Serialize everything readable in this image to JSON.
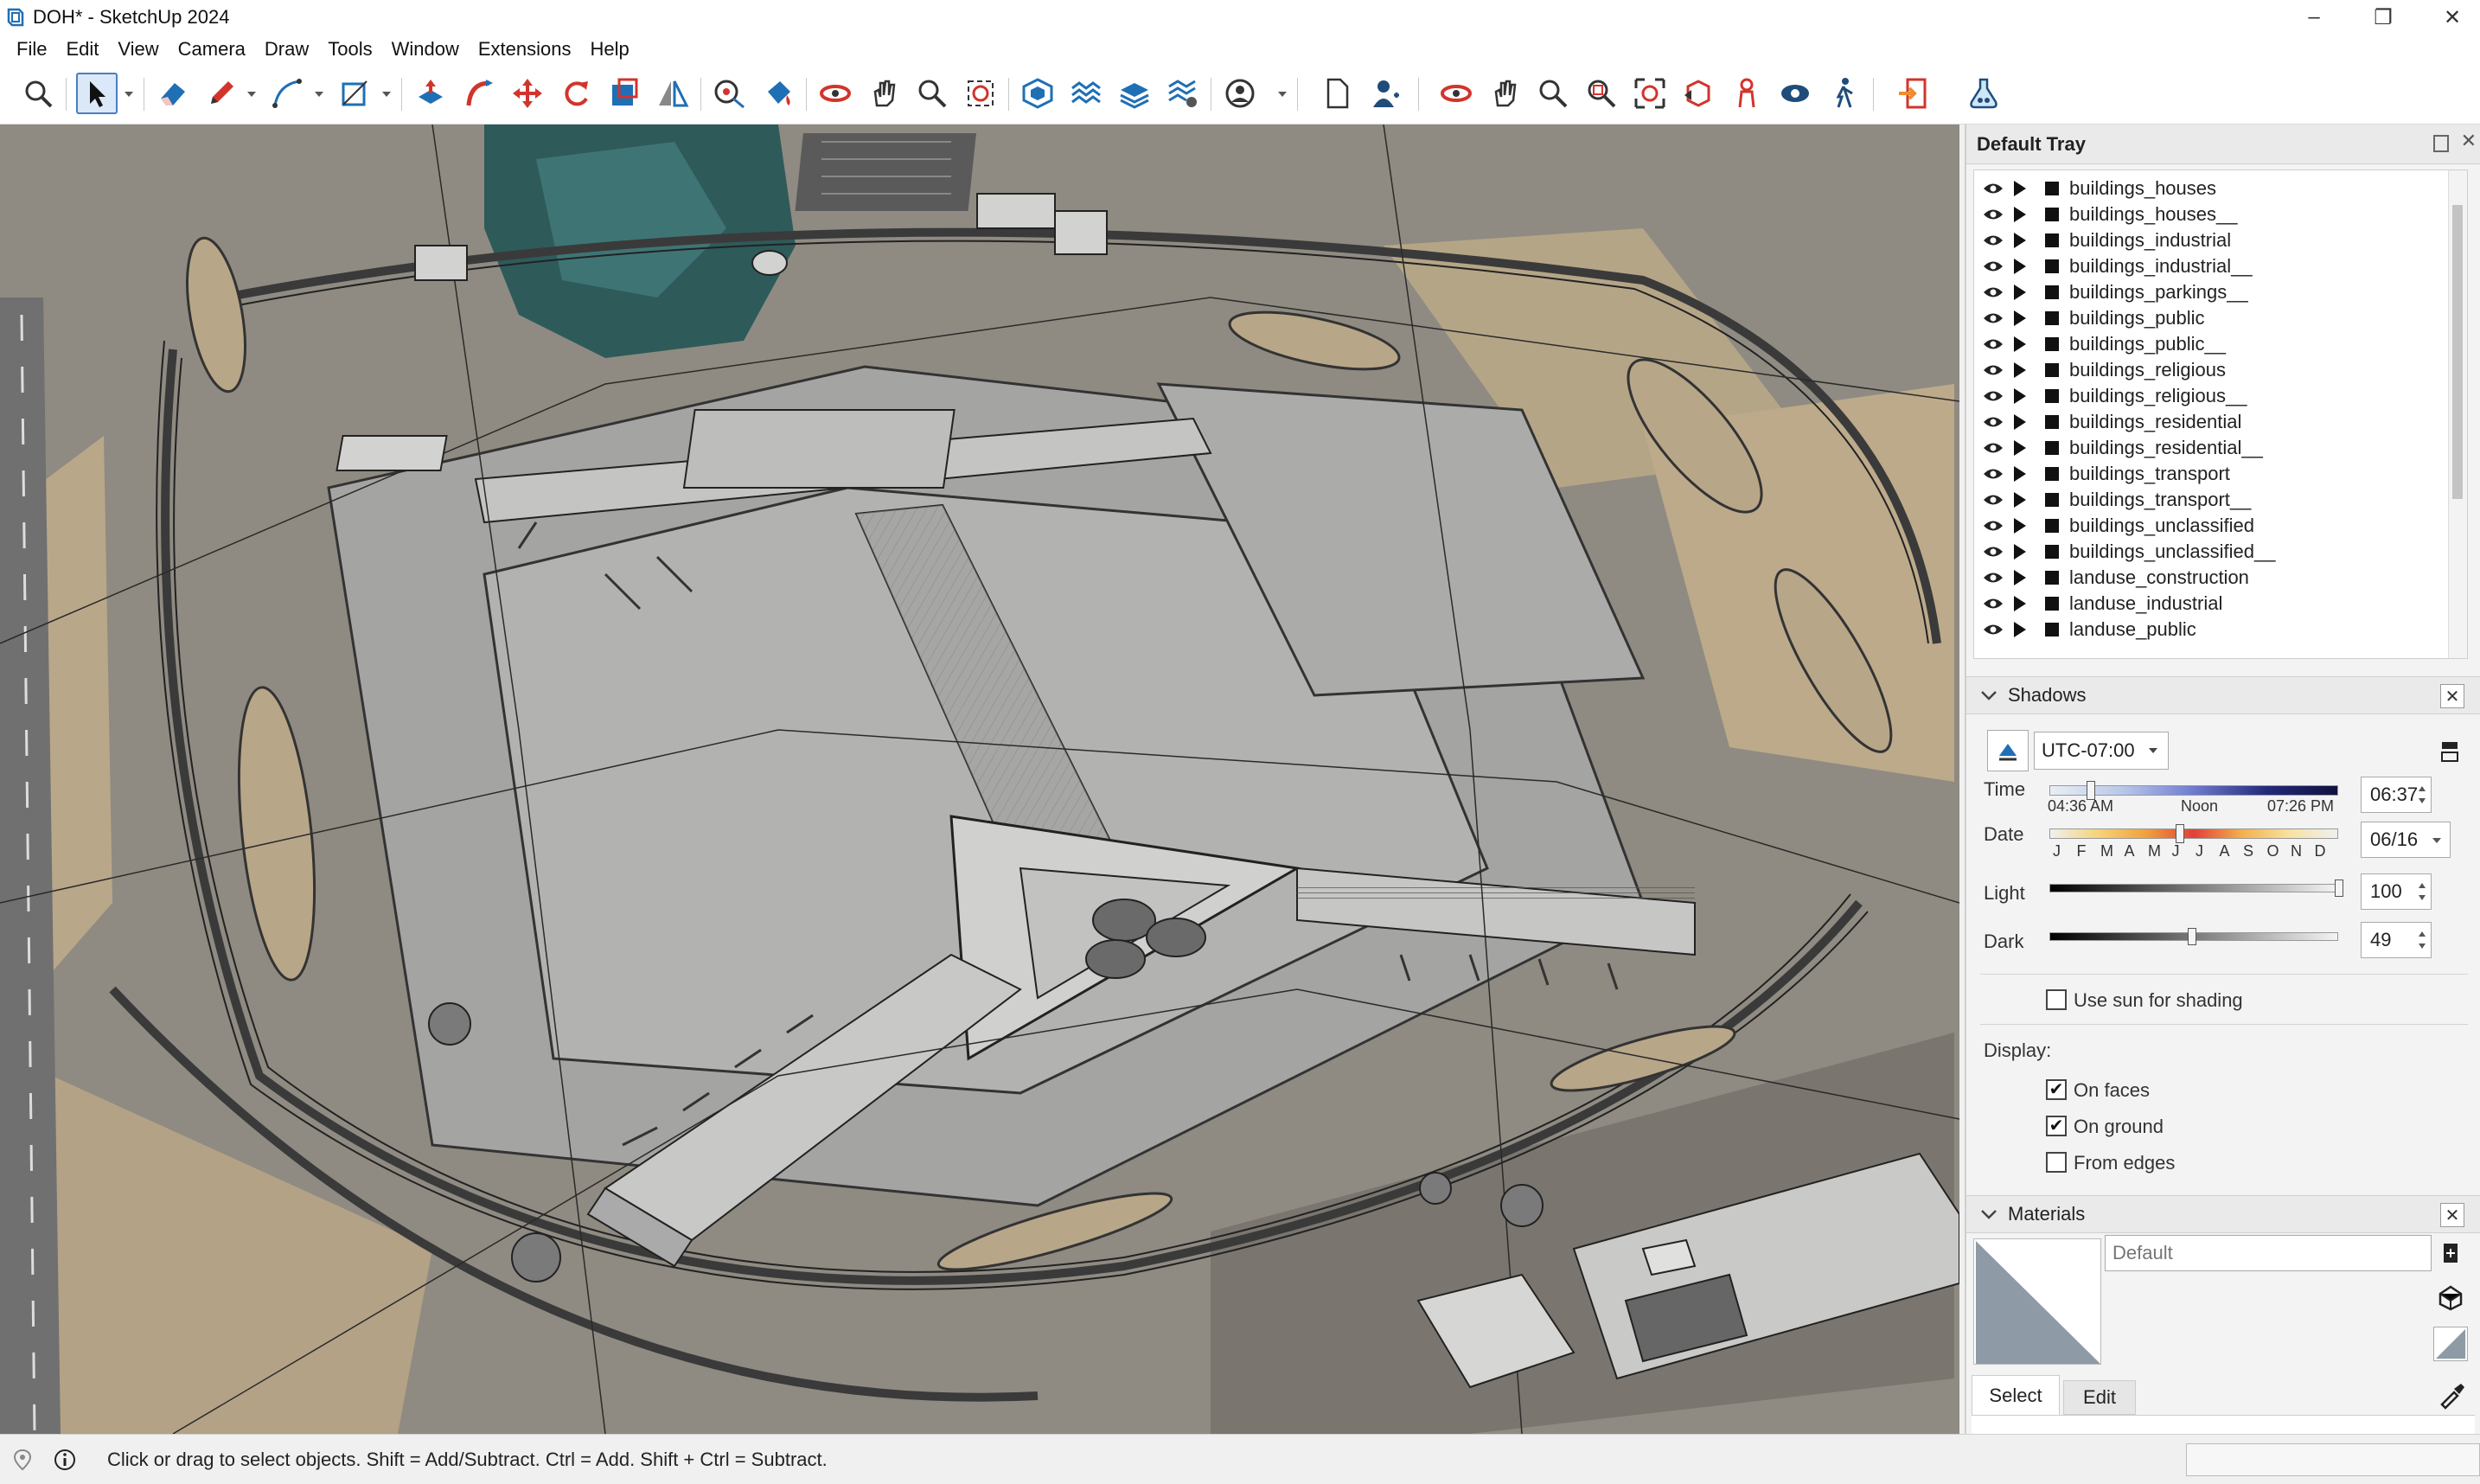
{
  "window": {
    "title": "DOH* - SketchUp 2024"
  },
  "menu": [
    "File",
    "Edit",
    "View",
    "Camera",
    "Draw",
    "Tools",
    "Window",
    "Extensions",
    "Help"
  ],
  "toolbar": {
    "icons": [
      "zoom-icon",
      "select-icon",
      "eraser-icon",
      "pencil-icon",
      "line-icon",
      "rectangle-icon",
      "push-pull-icon",
      "follow-me-icon",
      "move-icon",
      "rotate-icon",
      "scale-icon",
      "flip-icon",
      "tape-measure-icon",
      "paint-bucket-icon",
      "orbit-icon",
      "pan-icon",
      "zoom-window-icon",
      "zoom-extents-icon",
      "warehouse-icon",
      "sandbox-icon",
      "layers-icon",
      "settings-icon",
      "account-icon",
      "new-file-icon",
      "user-icon",
      "orbit-icon-2",
      "pan-icon-2",
      "zoom-icon-2",
      "zoom-window-icon-2",
      "zoom-extents-icon-2",
      "previous-view-icon",
      "position-camera-icon",
      "look-around-icon",
      "walk-icon",
      "exit-icon",
      "extension-icon"
    ]
  },
  "tray": {
    "title": "Default Tray",
    "tags": [
      "buildings_houses",
      "buildings_houses__",
      "buildings_industrial",
      "buildings_industrial__",
      "buildings_parkings__",
      "buildings_public",
      "buildings_public__",
      "buildings_religious",
      "buildings_religious__",
      "buildings_residential",
      "buildings_residential__",
      "buildings_transport",
      "buildings_transport__",
      "buildings_unclassified",
      "buildings_unclassified__",
      "landuse_construction",
      "landuse_industrial",
      "landuse_public"
    ]
  },
  "shadows": {
    "title": "Shadows",
    "timezone": "UTC-07:00",
    "time_label": "Time",
    "time_start": "04:36 AM",
    "time_noon": "Noon",
    "time_end": "07:26 PM",
    "time_value": "06:37",
    "time_fraction": 0.14,
    "date_label": "Date",
    "months": [
      "J",
      "F",
      "M",
      "A",
      "M",
      "J",
      "J",
      "A",
      "S",
      "O",
      "N",
      "D"
    ],
    "date_value": "06/16",
    "date_fraction": 0.45,
    "light_label": "Light",
    "light_value": "100",
    "dark_label": "Dark",
    "dark_value": "49",
    "use_sun_label": "Use sun for shading",
    "use_sun_checked": false,
    "display_label": "Display:",
    "on_faces_label": "On faces",
    "on_faces_checked": true,
    "on_ground_label": "On ground",
    "on_ground_checked": true,
    "from_edges_label": "From edges",
    "from_edges_checked": false
  },
  "materials": {
    "title": "Materials",
    "name_placeholder": "Default",
    "tab_select": "Select",
    "tab_edit": "Edit"
  },
  "status": {
    "message": "Click or drag to select objects. Shift = Add/Subtract. Ctrl = Add. Shift + Ctrl = Subtract."
  },
  "colors": {
    "accent": "#4a7fc1",
    "toolbar_red": "#d2342c",
    "toolbar_blue": "#1f6fb5",
    "ground": "#8d8980",
    "terminal": "#c8c8c8"
  }
}
